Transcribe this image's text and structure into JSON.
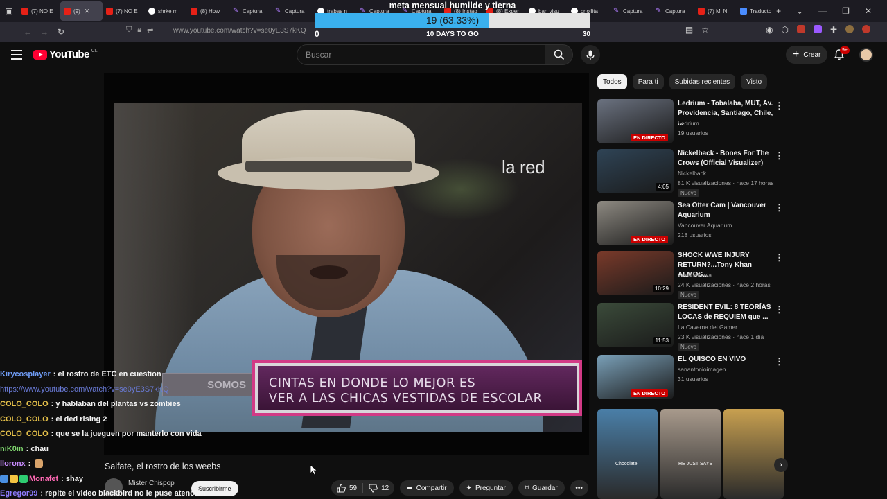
{
  "browser": {
    "tabs": [
      {
        "label": "(7) NO E",
        "icon": "youtube-icon",
        "active": false
      },
      {
        "label": "(9)",
        "icon": "youtube-icon",
        "active": true
      },
      {
        "label": "(7) NO E",
        "icon": "youtube-icon",
        "active": false
      },
      {
        "label": "shrke m",
        "icon": "google-icon",
        "active": false
      },
      {
        "label": "(8) How",
        "icon": "youtube-icon",
        "active": false
      },
      {
        "label": "Captura",
        "icon": "pen-icon",
        "active": false
      },
      {
        "label": "Captura",
        "icon": "pen-icon",
        "active": false
      },
      {
        "label": "trabas n",
        "icon": "google-icon",
        "active": false
      },
      {
        "label": "Captura",
        "icon": "pen-icon",
        "active": false
      },
      {
        "label": "Captura",
        "icon": "pen-icon",
        "active": false
      },
      {
        "label": "(8) Instag",
        "icon": "instagram-icon",
        "active": false
      },
      {
        "label": "(8) Exper",
        "icon": "youtube-icon",
        "active": false
      },
      {
        "label": "ban visu",
        "icon": "google-icon",
        "active": false
      },
      {
        "label": "criollita",
        "icon": "google-icon",
        "active": false
      },
      {
        "label": "Captura",
        "icon": "pen-icon",
        "active": false
      },
      {
        "label": "Captura",
        "icon": "pen-icon",
        "active": false
      },
      {
        "label": "(7) Mi N",
        "icon": "youtube-icon",
        "active": false
      },
      {
        "label": "Traducto",
        "icon": "translate-icon",
        "active": false
      }
    ],
    "url": "www.youtube.com/watch?v=se0yE3S7kKQ"
  },
  "goal": {
    "title": "meta mensual humilde y tierna",
    "progress_text": "19 (63.33%)",
    "progress_fraction": 0.6333,
    "min_label": "0",
    "days_label": "10 DAYS TO GO",
    "max_label": "30",
    "fill_color": "#3ab0ee"
  },
  "youtube": {
    "logo_text": "YouTube",
    "country_code": "CL",
    "search_placeholder": "Buscar",
    "create_label": "Crear",
    "notifications_badge": "9+",
    "brand_color": "#ff0033"
  },
  "player": {
    "watermark": "la red",
    "lower_third_line1": "CINTAS EN DONDE LO MEJOR ES",
    "lower_third_line2": "VER A LAS CHICAS VESTIDAS DE ESCOLAR",
    "lower_third_tag": "SOMOS"
  },
  "video": {
    "title": "Salfate, el rostro de los weebs",
    "channel": "Mister Chispop",
    "subscribe_label": "Suscribirme",
    "likes": "59",
    "dislikes": "12",
    "share_label": "Compartir",
    "ask_label": "Preguntar",
    "save_label": "Guardar"
  },
  "chat": [
    {
      "user": "Kirycosplayer",
      "color": "#6f9cf5",
      "message": ": el rostro de ETC en cuestion"
    },
    {
      "user": "",
      "color": "#6a7bd8",
      "message": "https://www.youtube.com/watch?v=se0yE3S7kKQ",
      "is_link": true
    },
    {
      "user": "COLO_COLO",
      "color": "#e6c14a",
      "message": ": y hablaban del plantas vs zombies"
    },
    {
      "user": "COLO_COLO",
      "color": "#e6c14a",
      "message": ": el ded rising 2"
    },
    {
      "user": "COLO_COLO",
      "color": "#e6c14a",
      "message": ": que se la jueguen por manterlo con vida"
    },
    {
      "user": "niK0in",
      "color": "#7fd66e",
      "message": ": chau"
    },
    {
      "user": "lloronx",
      "color": "#c88cff",
      "message": ":"
    },
    {
      "user": "Monafet",
      "color": "#ff69b4",
      "message": ": shay"
    },
    {
      "user": "Egregor99",
      "color": "#8f7cff",
      "message": ": repite el video blackbird no le puse atención"
    }
  ],
  "sidebar": {
    "chips": [
      {
        "label": "Todos",
        "active": true
      },
      {
        "label": "Para ti",
        "active": false
      },
      {
        "label": "Subidas recientes",
        "active": false
      },
      {
        "label": "Visto",
        "active": false
      }
    ],
    "videos": [
      {
        "title": "Ledrium - Tobalaba, MUT, Av. Providencia, Santiago, Chile, ...",
        "channel": "Ledrium",
        "meta": "19 usuarios",
        "live_label": "EN DIRECTO",
        "duration": "",
        "badge": "",
        "thumb": "#6b7280"
      },
      {
        "title": "Nickelback - Bones For The Crows (Official Visualizer)",
        "channel": "Nickelback",
        "meta": "81 K visualizaciones · hace 17 horas",
        "live_label": "",
        "duration": "4:05",
        "badge": "Nuevo",
        "thumb": "#2f4456"
      },
      {
        "title": "Sea Otter Cam | Vancouver Aquarium",
        "channel": "Vancouver Aquarium",
        "meta": "218 usuarios",
        "live_label": "EN DIRECTO",
        "duration": "",
        "badge": "",
        "thumb": "#8e8a82"
      },
      {
        "title": "SHOCK WWE INJURY RETURN?...Tony Khan ALMOS...",
        "channel": "Wrestlelamia",
        "meta": "24 K visualizaciones · hace 2 horas",
        "live_label": "",
        "duration": "10:29",
        "badge": "Nuevo",
        "thumb": "#7a3a2a"
      },
      {
        "title": "RESIDENT EVIL: 8 TEORÍAS LOCAS de REQUIEM que ...",
        "channel": "La Caverna del Gamer",
        "meta": "23 K visualizaciones · hace 1 día",
        "live_label": "",
        "duration": "11:53",
        "badge": "Nuevo",
        "thumb": "#3b4b3a"
      },
      {
        "title": "EL QUISCO EN VIVO",
        "channel": "sanantonioimagen",
        "meta": "31 usuarios",
        "live_label": "EN DIRECTO",
        "duration": "",
        "badge": "",
        "thumb": "#7aa0b8"
      }
    ],
    "shorts": [
      {
        "label": "Chocolate",
        "color": "#4a7fa8"
      },
      {
        "label": "HE JUST SAYS",
        "color": "#a89a8c"
      },
      {
        "label": "",
        "color": "#c8a050"
      }
    ]
  }
}
